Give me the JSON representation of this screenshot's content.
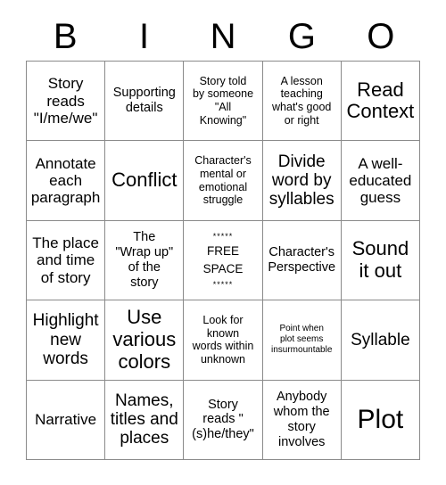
{
  "card": {
    "title_letters": [
      "B",
      "I",
      "N",
      "G",
      "O"
    ],
    "border_color": "#8a8a8a",
    "text_color": "#000000",
    "background_color": "#ffffff",
    "rows": [
      [
        {
          "text": "Story\nreads\n\"I/me/we\"",
          "size": "fs-lg"
        },
        {
          "text": "Supporting\ndetails",
          "size": "fs-md"
        },
        {
          "text": "Story told\nby someone\n\"All\nKnowing\"",
          "size": "fs-sm"
        },
        {
          "text": "A lesson\nteaching\nwhat's good\nor right",
          "size": "fs-sm"
        },
        {
          "text": "Read\nContext",
          "size": "fs-xxl"
        }
      ],
      [
        {
          "text": "Annotate\neach\nparagraph",
          "size": "fs-lg"
        },
        {
          "text": "Conflict",
          "size": "fs-xxl"
        },
        {
          "text": "Character's\nmental or\nemotional\nstruggle",
          "size": "fs-sm"
        },
        {
          "text": "Divide\nword by\nsyllables",
          "size": "fs-xl"
        },
        {
          "text": "A well-\neducated\nguess",
          "size": "fs-lg"
        }
      ],
      [
        {
          "text": "The place\nand time\nof story",
          "size": "fs-lg"
        },
        {
          "text": "The\n\"Wrap up\"\nof the\nstory",
          "size": "fs-md"
        },
        {
          "text": "FREE\nSPACE",
          "size": "free",
          "stars": "*****"
        },
        {
          "text": "Character's\nPerspective",
          "size": "fs-md"
        },
        {
          "text": "Sound\nit out",
          "size": "fs-xxl"
        }
      ],
      [
        {
          "text": "Highlight\nnew\nwords",
          "size": "fs-xl"
        },
        {
          "text": "Use\nvarious\ncolors",
          "size": "fs-xxl"
        },
        {
          "text": "Look for\nknown\nwords within\nunknown",
          "size": "fs-sm"
        },
        {
          "text": "Point when\nplot seems\ninsurmountable",
          "size": "fs-xs"
        },
        {
          "text": "Syllable",
          "size": "fs-xl"
        }
      ],
      [
        {
          "text": "Narrative",
          "size": "fs-lg"
        },
        {
          "text": "Names,\ntitles and\nplaces",
          "size": "fs-xl"
        },
        {
          "text": "Story\nreads \"\n(s)he/they\"",
          "size": "fs-md"
        },
        {
          "text": "Anybody\nwhom the\nstory\ninvolves",
          "size": "fs-md"
        },
        {
          "text": "Plot",
          "size": "fs-huge"
        }
      ]
    ]
  }
}
